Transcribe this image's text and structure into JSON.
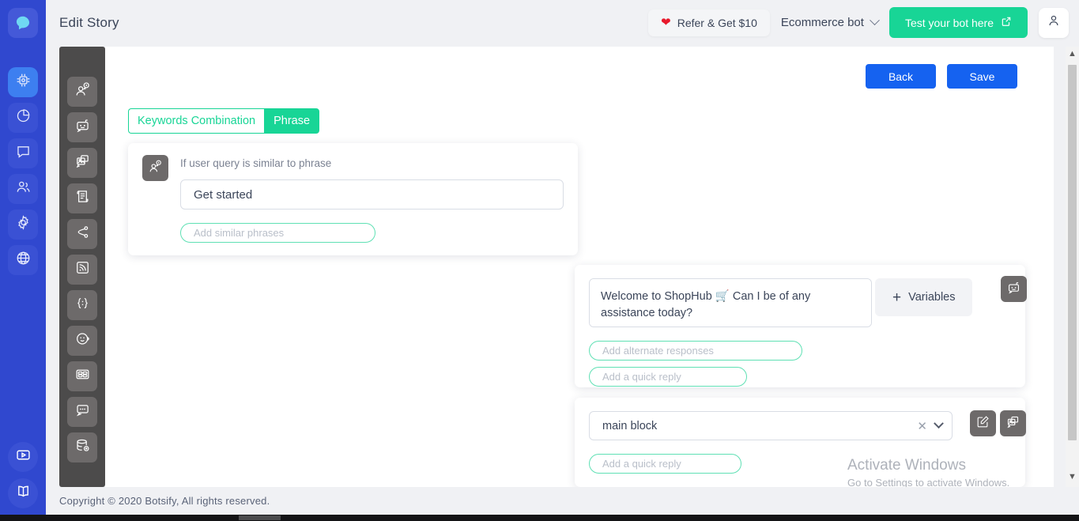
{
  "header": {
    "title": "Edit Story",
    "refer_label": "Refer & Get $10",
    "heart_icon": "heart-icon",
    "bot_name": "Ecommerce bot",
    "test_label": "Test your bot here",
    "external_icon": "external-link-icon",
    "account_icon": "user-account-icon"
  },
  "rail": {
    "logo_icon": "botsify-logo-icon",
    "items": [
      {
        "icon": "chip-ai-icon",
        "name": "sidebar-item-ai",
        "active": true
      },
      {
        "icon": "pie-chart-icon",
        "name": "sidebar-item-analytics",
        "active": false
      },
      {
        "icon": "chat-bubble-icon",
        "name": "sidebar-item-conversations",
        "active": false
      },
      {
        "icon": "users-icon",
        "name": "sidebar-item-users",
        "active": false
      },
      {
        "icon": "gear-icon",
        "name": "sidebar-item-settings",
        "active": false
      },
      {
        "icon": "globe-icon",
        "name": "sidebar-item-integrations",
        "active": false
      }
    ],
    "bottom": [
      {
        "icon": "video-play-icon",
        "name": "sidebar-item-tutorials"
      },
      {
        "icon": "book-icon",
        "name": "sidebar-item-docs"
      }
    ]
  },
  "toolbar": {
    "items": [
      {
        "icon": "user-query-icon",
        "name": "tool-user-query"
      },
      {
        "icon": "bot-response-icon",
        "name": "tool-bot-response"
      },
      {
        "icon": "media-gallery-icon",
        "name": "tool-media"
      },
      {
        "icon": "form-icon",
        "name": "tool-form"
      },
      {
        "icon": "branch-icon",
        "name": "tool-branch"
      },
      {
        "icon": "rss-api-icon",
        "name": "tool-api"
      },
      {
        "icon": "code-braces-icon",
        "name": "tool-code"
      },
      {
        "icon": "agent-headset-icon",
        "name": "tool-human-agent"
      },
      {
        "icon": "card-grid-icon",
        "name": "tool-cards"
      },
      {
        "icon": "typing-bubble-icon",
        "name": "tool-typing"
      },
      {
        "icon": "database-add-icon",
        "name": "tool-database"
      }
    ]
  },
  "canvas": {
    "back_label": "Back",
    "save_label": "Save",
    "keywords": {
      "combination_label": "Keywords Combination",
      "match_type": "Phrase"
    },
    "user_block": {
      "avatar_icon": "user-query-icon",
      "hint": "If user query is similar to phrase",
      "phrase_value": "Get started",
      "phrase_placeholder": "",
      "similar_placeholder": "Add similar phrases"
    },
    "bot_block": {
      "avatar_icon": "bot-response-icon",
      "message": "Welcome to ShopHub 🛒 Can I be of any assistance today?",
      "variables_label": "Variables",
      "plus_icon": "plus-icon",
      "alternate_placeholder": "Add alternate responses",
      "quick_reply_placeholder": "Add a quick reply"
    },
    "block_link": {
      "selected_block": "main block",
      "clear_icon": "close-x-icon",
      "dropdown_icon": "chevron-down-icon",
      "edit_icon": "edit-pencil-icon",
      "media_icon": "media-gallery-icon",
      "quick_reply_placeholder": "Add a quick reply"
    }
  },
  "scrollbar": {
    "up_icon": "chevron-up-icon",
    "down_icon": "chevron-down-icon"
  },
  "watermark": {
    "line1": "Activate Windows",
    "line2": "Go to Settings to activate Windows."
  },
  "footer": {
    "copyright": "Copyright © 2020 Botsify, All rights reserved."
  },
  "colors": {
    "rail_blue": "#3048cf",
    "accent_green": "#18d596",
    "primary_blue": "#1562f0",
    "tool_dark": "#4c4b4b"
  }
}
